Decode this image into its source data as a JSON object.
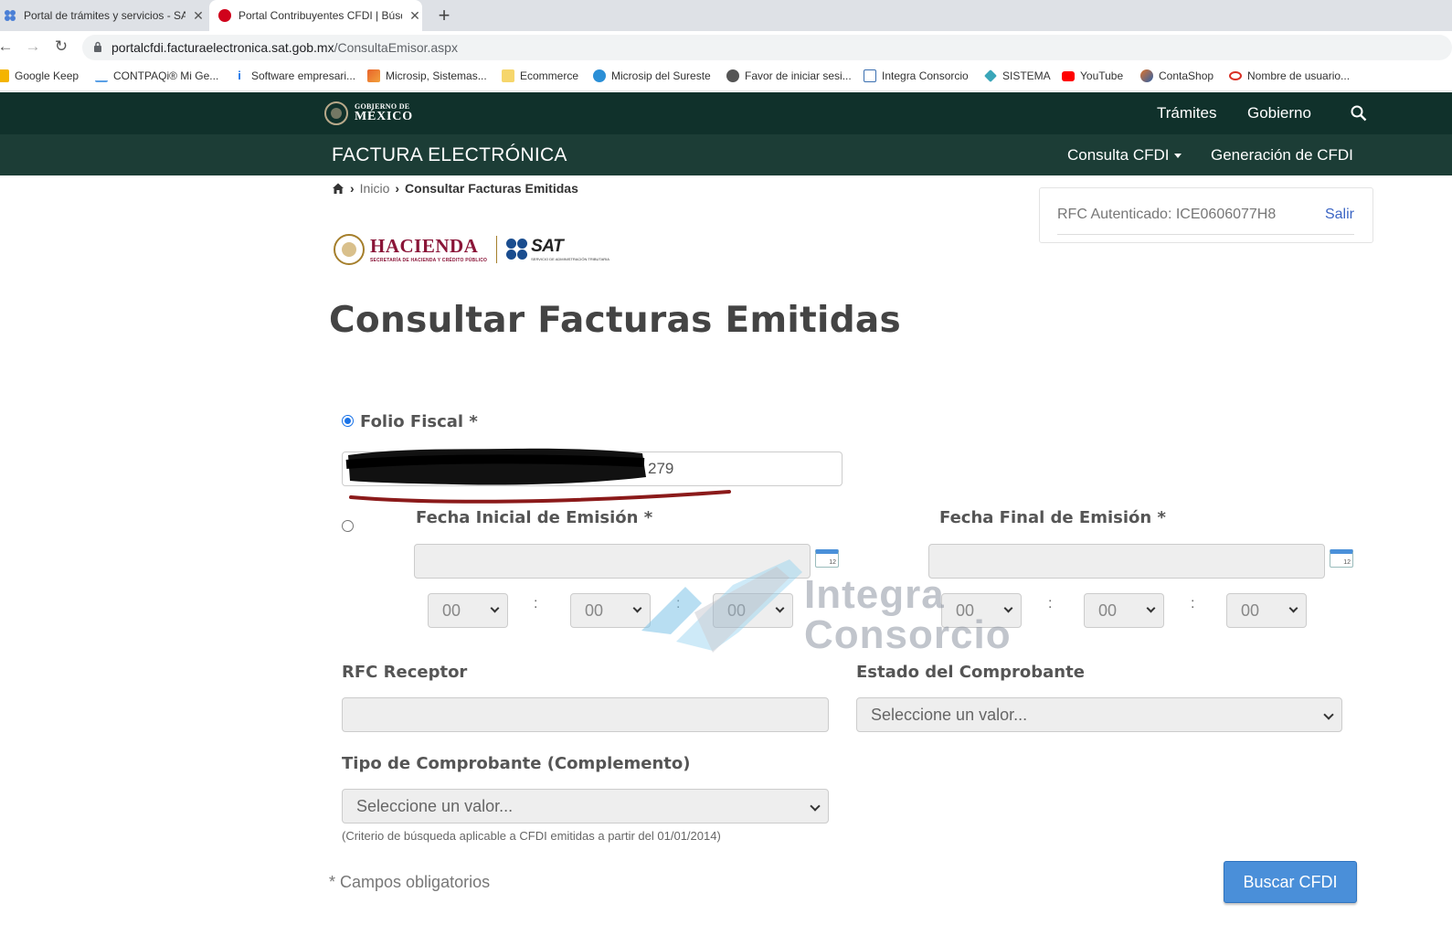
{
  "browser": {
    "tabs": [
      {
        "title": "Portal de trámites y servicios - SAT",
        "active": false
      },
      {
        "title": "Portal Contribuyentes CFDI | Búsqueda",
        "active": true
      }
    ],
    "url_host": "portalcfdi.facturaelectronica.sat.gob.mx",
    "url_path": "/ConsultaEmisor.aspx",
    "bookmarks": [
      {
        "label": "Google Keep",
        "color": "#f4b400"
      },
      {
        "label": "CONTPAQi® Mi Ge...",
        "color": "#5aa0e6"
      },
      {
        "label": "Software empresari...",
        "color": "#1a73e8"
      },
      {
        "label": "Microsip, Sistemas...",
        "color": "#e8632b"
      },
      {
        "label": "Ecommerce",
        "color": "#f6d66b"
      },
      {
        "label": "Microsip del Sureste",
        "color": "#2b8fd6"
      },
      {
        "label": "Favor de iniciar sesi...",
        "color": "#555555"
      },
      {
        "label": "Integra Consorcio",
        "color": "#3a6fb0"
      },
      {
        "label": "SISTEMA",
        "color": "#3aa6b9"
      },
      {
        "label": "YouTube",
        "color": "#ff0000"
      },
      {
        "label": "ContaShop",
        "color": "#e0742b"
      },
      {
        "label": "Nombre de usuario...",
        "color": "#d93025"
      }
    ]
  },
  "gob_header": {
    "logo_line1": "GOBIERNO DE",
    "logo_line2": "MÉXICO",
    "links": [
      "Trámites",
      "Gobierno"
    ]
  },
  "fe_header": {
    "title": "FACTURA ELECTRÓNICA",
    "menu": [
      "Consulta CFDI",
      "Generación de CFDI"
    ]
  },
  "breadcrumb": {
    "home": "Inicio",
    "current": "Consultar Facturas Emitidas"
  },
  "auth": {
    "rfc_text": "RFC Autenticado: ICE0606077H8",
    "logout": "Salir"
  },
  "logos": {
    "hacienda": "HACIENDA",
    "hacienda_sub": "SECRETARÍA DE HACIENDA Y CRÉDITO PÚBLICO",
    "sat": "SAT",
    "sat_sub": "SERVICIO DE ADMINISTRACIÓN TRIBUTARIA"
  },
  "page_title": "Consultar Facturas Emitidas",
  "form": {
    "folio_label": "Folio Fiscal *",
    "folio_value_visible": "279",
    "folio_selected": true,
    "fecha_inicial_label": "Fecha Inicial de Emisión *",
    "fecha_final_label": "Fecha Final de Emisión *",
    "time_value": "00",
    "colon": ":",
    "rfc_receptor_label": "RFC Receptor",
    "estado_label": "Estado del Comprobante",
    "estado_value": "Seleccione un valor...",
    "tipo_label": "Tipo de Comprobante (Complemento)",
    "tipo_value": "Seleccione un valor...",
    "criterio": "(Criterio de búsqueda aplicable a CFDI emitidas a partir del 01/01/2014)",
    "obligatorios": "* Campos obligatorios",
    "submit": "Buscar CFDI"
  },
  "watermark": {
    "line1": "Integra",
    "line2": "Consorcio"
  }
}
